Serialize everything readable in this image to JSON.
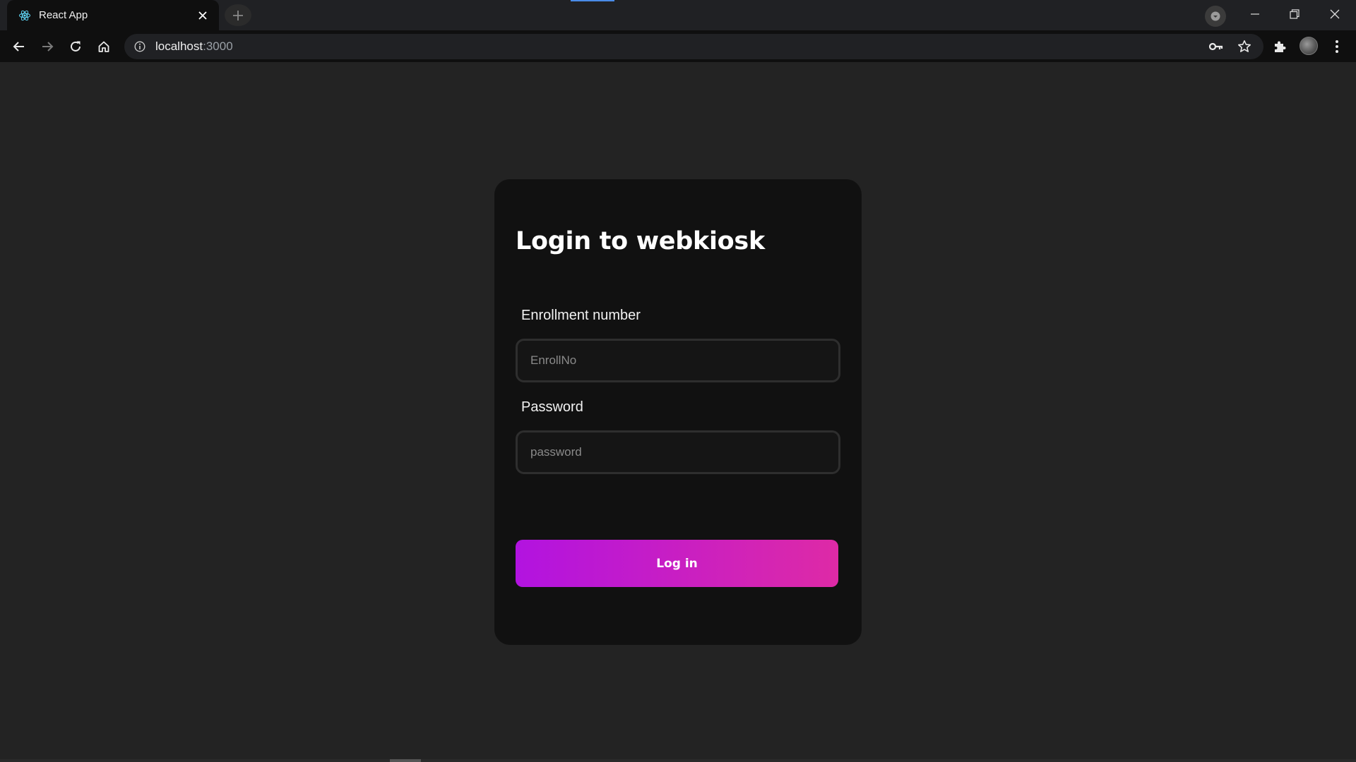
{
  "browser": {
    "tab": {
      "title": "React App",
      "favicon": "react-logo-icon"
    },
    "address": {
      "host": "localhost",
      "port": ":3000"
    },
    "icons": {
      "back": "arrow-left-icon",
      "forward": "arrow-right-icon",
      "reload": "reload-icon",
      "home": "home-icon",
      "site_info": "info-icon",
      "password": "key-icon",
      "bookmark": "star-icon",
      "extensions": "puzzle-icon",
      "menu": "kebab-menu-icon"
    }
  },
  "login": {
    "title": "Login to webkiosk",
    "enrollment": {
      "label": "Enrollment number",
      "placeholder": "EnrollNo",
      "value": ""
    },
    "password": {
      "label": "Password",
      "placeholder": "password",
      "value": ""
    },
    "submit_label": "Log in"
  },
  "colors": {
    "page_background": "#232323",
    "card_background": "#111111",
    "button_gradient_start": "#b213e0",
    "button_gradient_end": "#de2aa6"
  }
}
